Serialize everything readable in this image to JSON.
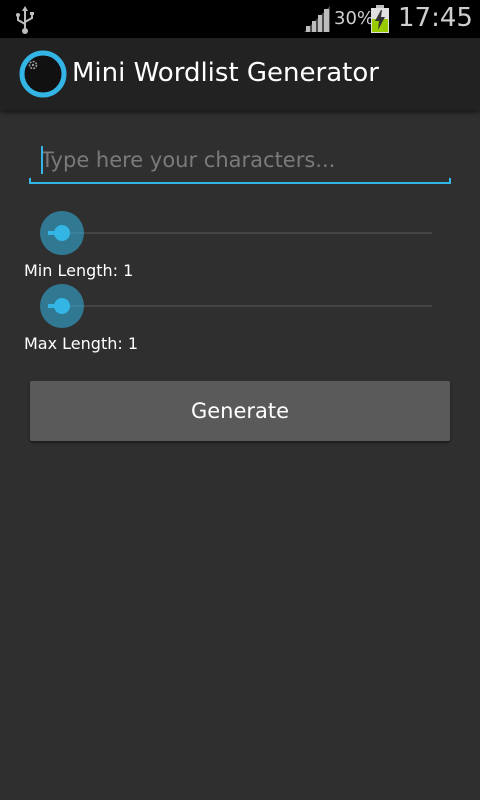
{
  "status_bar": {
    "battery_percent": "30%",
    "time": "17:45",
    "icons": [
      "usb-icon",
      "signal-icon",
      "battery-charging-icon"
    ]
  },
  "action_bar": {
    "title": "Mini Wordlist Generator",
    "logo_icon": "app-logo-icon"
  },
  "input": {
    "value": "",
    "placeholder": "Type here your characters..."
  },
  "min_slider": {
    "label": "Min Length: 1",
    "value": 1,
    "fraction": 0.0
  },
  "max_slider": {
    "label": "Max Length: 1",
    "value": 1,
    "fraction": 0.0
  },
  "generate_button": {
    "label": "Generate"
  },
  "colors": {
    "accent": "#33b5e5",
    "background": "#2f2f2f",
    "action_bar": "#222222",
    "button": "#5a5a5a"
  }
}
